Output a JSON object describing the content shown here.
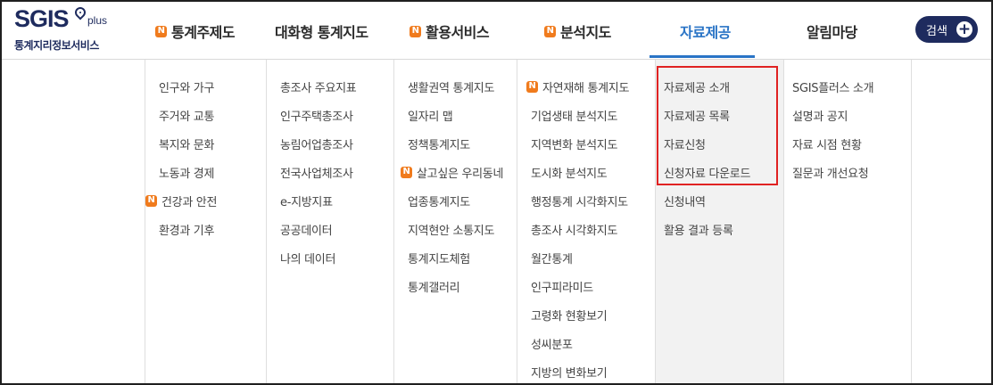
{
  "logo": {
    "main": "SGIS",
    "plus": "plus",
    "sub": "통계지리정보서비스"
  },
  "nav": [
    {
      "label": "통계주제도",
      "badge": "N"
    },
    {
      "label": "대화형 통계지도",
      "badge": ""
    },
    {
      "label": "활용서비스",
      "badge": "N"
    },
    {
      "label": "분석지도",
      "badge": "N"
    },
    {
      "label": "자료제공",
      "badge": ""
    },
    {
      "label": "알림마당",
      "badge": ""
    }
  ],
  "search": {
    "label": "검색",
    "icon": "+"
  },
  "badge_text": "N",
  "colors": {
    "brand": "#1e2b5e",
    "active": "#2a74c6",
    "badge": "#f07b1d",
    "highlight": "#e02222"
  },
  "menus": [
    {
      "items": [
        {
          "label": "인구와 가구",
          "badge": ""
        },
        {
          "label": "주거와 교통",
          "badge": ""
        },
        {
          "label": "복지와 문화",
          "badge": ""
        },
        {
          "label": "노동과 경제",
          "badge": ""
        },
        {
          "label": "건강과 안전",
          "badge": "N"
        },
        {
          "label": "환경과 기후",
          "badge": ""
        }
      ]
    },
    {
      "items": [
        {
          "label": "총조사 주요지표",
          "badge": ""
        },
        {
          "label": "인구주택총조사",
          "badge": ""
        },
        {
          "label": "농림어업총조사",
          "badge": ""
        },
        {
          "label": "전국사업체조사",
          "badge": ""
        },
        {
          "label": "e-지방지표",
          "badge": ""
        },
        {
          "label": "공공데이터",
          "badge": ""
        },
        {
          "label": "나의 데이터",
          "badge": ""
        }
      ]
    },
    {
      "items": [
        {
          "label": "생활권역 통계지도",
          "badge": ""
        },
        {
          "label": "일자리 맵",
          "badge": ""
        },
        {
          "label": "정책통계지도",
          "badge": ""
        },
        {
          "label": "살고싶은 우리동네",
          "badge": "N"
        },
        {
          "label": "업종통계지도",
          "badge": ""
        },
        {
          "label": "지역현안 소통지도",
          "badge": ""
        },
        {
          "label": "통계지도체험",
          "badge": ""
        },
        {
          "label": "통계갤러리",
          "badge": ""
        }
      ]
    },
    {
      "items": [
        {
          "label": "자연재해 통계지도",
          "badge": "N"
        },
        {
          "label": "기업생태 분석지도",
          "badge": ""
        },
        {
          "label": "지역변화 분석지도",
          "badge": ""
        },
        {
          "label": "도시화 분석지도",
          "badge": ""
        },
        {
          "label": "행정통계 시각화지도",
          "badge": ""
        },
        {
          "label": "총조사 시각화지도",
          "badge": ""
        },
        {
          "label": "월간통계",
          "badge": ""
        },
        {
          "label": "인구피라미드",
          "badge": ""
        },
        {
          "label": "고령화 현황보기",
          "badge": ""
        },
        {
          "label": "성씨분포",
          "badge": ""
        },
        {
          "label": "지방의 변화보기",
          "badge": ""
        }
      ]
    },
    {
      "items": [
        {
          "label": "자료제공 소개",
          "badge": ""
        },
        {
          "label": "자료제공 목록",
          "badge": ""
        },
        {
          "label": "자료신청",
          "badge": ""
        },
        {
          "label": "신청자료 다운로드",
          "badge": ""
        },
        {
          "label": "신청내역",
          "badge": ""
        },
        {
          "label": "활용 결과 등록",
          "badge": ""
        }
      ]
    },
    {
      "items": [
        {
          "label": "SGIS플러스 소개",
          "badge": ""
        },
        {
          "label": "설명과 공지",
          "badge": ""
        },
        {
          "label": "자료 시점 현황",
          "badge": ""
        },
        {
          "label": "질문과 개선요청",
          "badge": ""
        }
      ]
    }
  ]
}
